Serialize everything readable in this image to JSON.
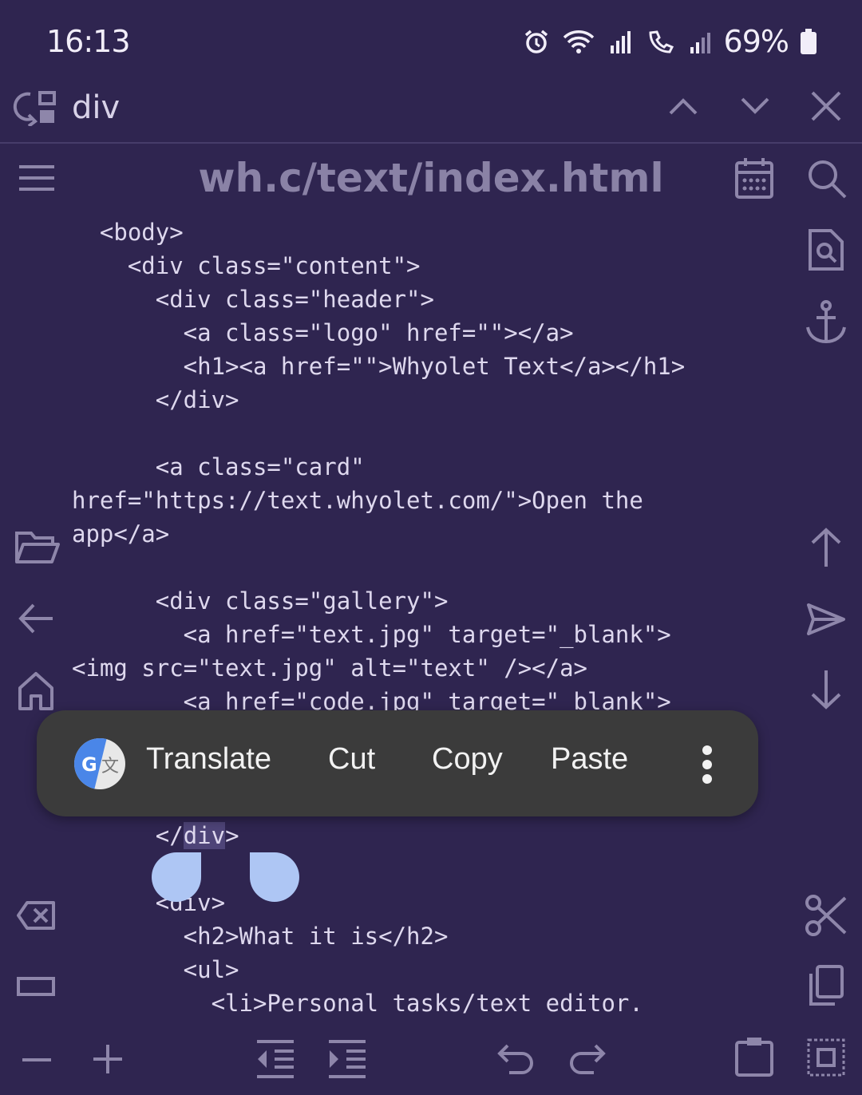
{
  "status_bar": {
    "time": "16:13",
    "battery": "69%"
  },
  "find_bar": {
    "query": "div"
  },
  "editor": {
    "title": "wh.c/text/index.html",
    "lines_before": [
      "  <body>",
      "    <div class=\"content\">",
      "      <div class=\"header\">",
      "        <a class=\"logo\" href=\"\"></a>",
      "        <h1><a href=\"\">Whyolet Text</a></h1>",
      "      </div>",
      "",
      "      <a class=\"card\"",
      "href=\"https://text.whyolet.com/\">Open the",
      "app</a>",
      "",
      "      <div class=\"gallery\">",
      "        <a href=\"text.jpg\" target=\"_blank\">",
      "<img src=\"text.jpg\" alt=\"text\" /></a>",
      "        <a href=\"code.jpg\" target=\"_blank\">"
    ],
    "selected_line": {
      "prefix": "      </",
      "selected": "div",
      "suffix": ">"
    },
    "lines_after": [
      "",
      "      <div>",
      "        <h2>What it is</h2>",
      "        <ul>",
      "          <li>Personal tasks/text editor."
    ]
  },
  "context_menu": {
    "translate": "Translate",
    "cut": "Cut",
    "copy": "Copy",
    "paste": "Paste"
  },
  "colors": {
    "background": "#2f2550",
    "icon": "#8e86aa",
    "menu": "#3b3b3b",
    "handle": "#aec6f4"
  }
}
